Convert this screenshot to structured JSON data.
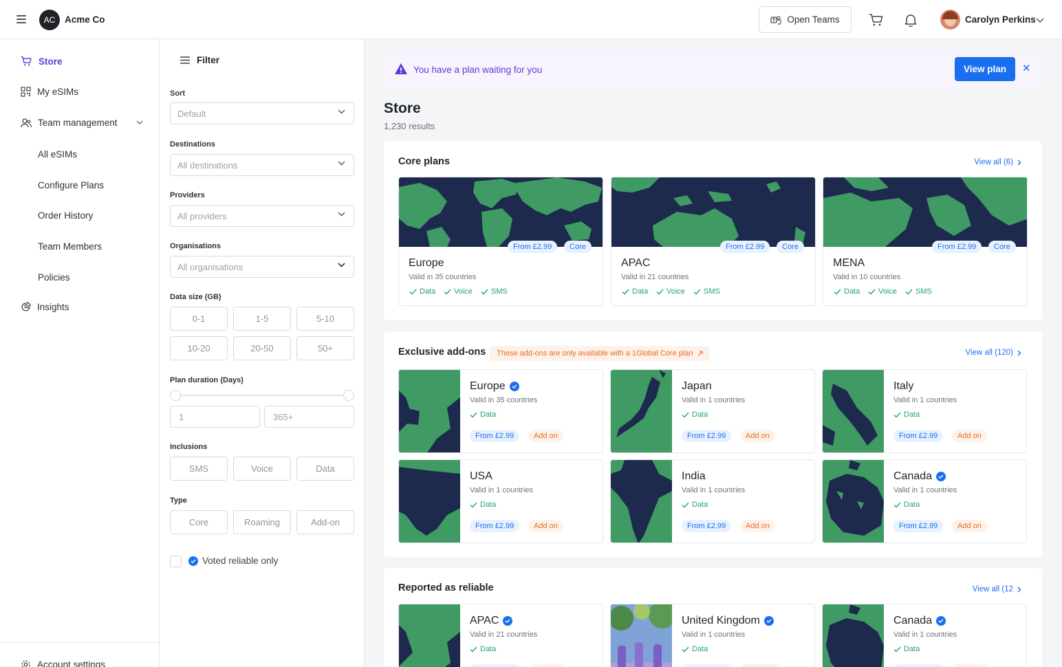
{
  "header": {
    "logo_initials": "AC",
    "company": "Acme Co",
    "open_teams_label": "Open Teams",
    "user_name": "Carolyn Perkins"
  },
  "sidebar": {
    "items": [
      {
        "label": "Store"
      },
      {
        "label": "My eSIMs"
      },
      {
        "label": "Team management"
      },
      {
        "label": "All eSIMs"
      },
      {
        "label": "Configure Plans"
      },
      {
        "label": "Order History"
      },
      {
        "label": "Team Members"
      },
      {
        "label": "Policies"
      },
      {
        "label": "Insights"
      }
    ],
    "account_settings": "Account settings"
  },
  "filter": {
    "title": "Filter",
    "sort_label": "Sort",
    "sort_value": "Default",
    "destinations_label": "Destinations",
    "destinations_value": "All destinations",
    "providers_label": "Providers",
    "providers_value": "All providers",
    "organisations_label": "Organisations",
    "organisations_value": "All organisations",
    "data_size_label": "Data size (GB)",
    "data_sizes": [
      "0-1",
      "1-5",
      "5-10",
      "10-20",
      "20-50",
      "50+"
    ],
    "duration_label": "Plan duration (Days)",
    "duration_min": "1",
    "duration_max": "365+",
    "inclusions_label": "Inclusions",
    "inclusions": [
      "SMS",
      "Voice",
      "Data"
    ],
    "type_label": "Type",
    "types": [
      "Core",
      "Roaming",
      "Add-on"
    ],
    "voted_label": "Voted reliable only"
  },
  "banner": {
    "text": "You have a plan waiting for you",
    "button": "View plan",
    "close": "✕"
  },
  "store": {
    "title": "Store",
    "count": "1,230 results"
  },
  "core_plans": {
    "title": "Core plans",
    "view_all": "View all (6)",
    "cards": [
      {
        "name": "Europe",
        "valid": "Valid in 35 countries",
        "from": "From £2.99",
        "tag": "Core",
        "inclusions": [
          "Data",
          "Voice",
          "SMS"
        ]
      },
      {
        "name": "APAC",
        "valid": "Valid in 21 countries",
        "from": "From £2.99",
        "tag": "Core",
        "inclusions": [
          "Data",
          "Voice",
          "SMS"
        ]
      },
      {
        "name": "MENA",
        "valid": "Valid in 10 countries",
        "from": "From £2.99",
        "tag": "Core",
        "inclusions": [
          "Data",
          "Voice",
          "SMS"
        ]
      }
    ]
  },
  "addons": {
    "title": "Exclusive add-ons",
    "note": "These add-ons are only available with a 1Global Core plan",
    "view_all": "View all (120)",
    "cards": [
      {
        "name": "Europe",
        "valid": "Valid in 35 countries",
        "data": "Data",
        "from": "From £2.99",
        "tag": "Add on"
      },
      {
        "name": "Japan",
        "valid": "Valid in 1 countries",
        "data": "Data",
        "from": "From £2.99",
        "tag": "Add on"
      },
      {
        "name": "Italy",
        "valid": "Valid in 1 countries",
        "data": "Data",
        "from": "From £2.99",
        "tag": "Add on"
      },
      {
        "name": "USA",
        "valid": "Valid in 1 countries",
        "data": "Data",
        "from": "From £2.99",
        "tag": "Add on"
      },
      {
        "name": "India",
        "valid": "Valid in 1 countries",
        "data": "Data",
        "from": "From £2.99",
        "tag": "Add on"
      },
      {
        "name": "Canada",
        "valid": "Valid in 1 countries",
        "data": "Data",
        "from": "From £2.99",
        "tag": "Add on"
      }
    ]
  },
  "reliable": {
    "title": "Reported as reliable",
    "view_all": "View all (12",
    "cards": [
      {
        "name": "APAC",
        "valid": "Valid in 21 countries",
        "data": "Data"
      },
      {
        "name": "United Kingdom",
        "valid": "Valid in 1 countries",
        "data": "Data"
      },
      {
        "name": "Canada",
        "valid": "Valid in 1 countries",
        "data": "Data"
      }
    ]
  },
  "colors": {
    "accent": "#5a3bd6",
    "primary": "#1a6ff0",
    "map_sea": "#1d2a4e",
    "map_land": "#3f9a63",
    "success": "#22a36a",
    "warning": "#ea6b1c"
  }
}
